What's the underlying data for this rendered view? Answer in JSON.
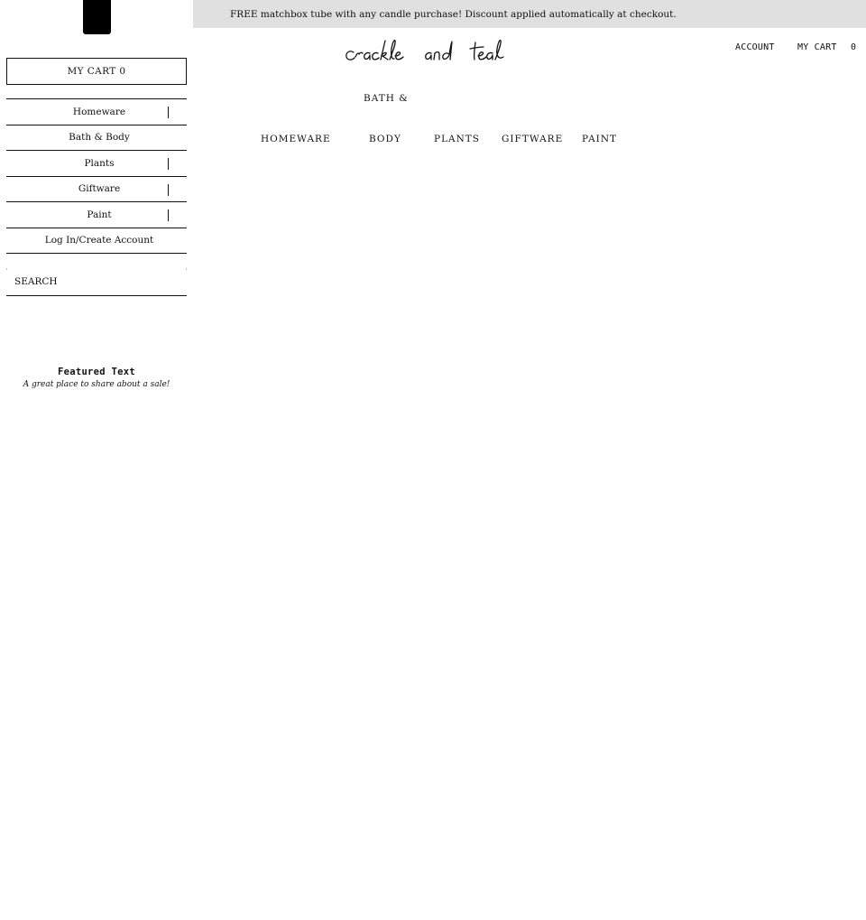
{
  "announcement": {
    "text": "FREE matchbox tube with any candle purchase! Discount applied automatically at checkout."
  },
  "brand": {
    "logo_text": "crackle and teal"
  },
  "header": {
    "account_label": "ACCOUNT",
    "cart_label": "MY CART",
    "cart_count": "0"
  },
  "main_nav": {
    "homeware": "HOMEWARE",
    "bath_line1": "BATH &",
    "bath_line2": "BODY",
    "plants": "PLANTS",
    "giftware": "GIFTWARE",
    "paint": "PAINT"
  },
  "drawer": {
    "cart_label": "MY CART 0",
    "items": [
      {
        "label": "Homeware",
        "has_children": true
      },
      {
        "label": "Bath & Body",
        "has_children": false
      },
      {
        "label": "Plants",
        "has_children": true
      },
      {
        "label": "Giftware",
        "has_children": true
      },
      {
        "label": "Paint",
        "has_children": true
      },
      {
        "label": "Log In/Create Account",
        "has_children": false
      }
    ],
    "search_placeholder": "SEARCH",
    "featured": {
      "title": "Featured Text",
      "subtitle": "A great place to share about a sale!"
    }
  },
  "colors": {
    "announcement_bg": "#e0e0e0",
    "text": "#111111",
    "close_button": "#000000"
  }
}
